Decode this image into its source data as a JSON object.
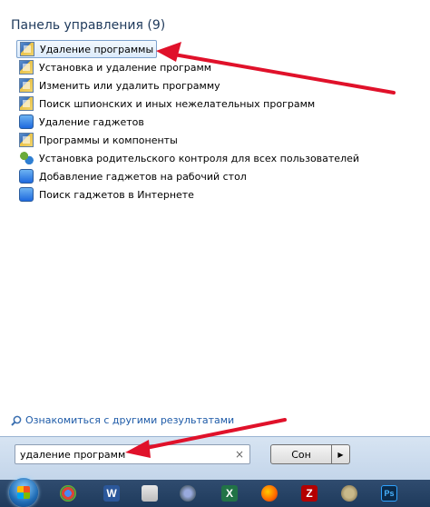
{
  "header": {
    "title": "Панель управления (9)"
  },
  "results": [
    {
      "label": "Удаление программы",
      "icon": "control-panel-icon"
    },
    {
      "label": "Установка и удаление программ",
      "icon": "control-panel-icon"
    },
    {
      "label": "Изменить или удалить программу",
      "icon": "control-panel-icon"
    },
    {
      "label": "Поиск шпионских и иных нежелательных программ",
      "icon": "control-panel-icon"
    },
    {
      "label": "Удаление гаджетов",
      "icon": "gadget-icon"
    },
    {
      "label": "Программы и компоненты",
      "icon": "control-panel-icon"
    },
    {
      "label": "Установка родительского контроля для всех пользователей",
      "icon": "parental-control-icon"
    },
    {
      "label": "Добавление гаджетов на рабочий стол",
      "icon": "gadget-icon"
    },
    {
      "label": "Поиск гаджетов в Интернете",
      "icon": "gadget-icon"
    }
  ],
  "more_results": {
    "label": "Ознакомиться с другими результатами"
  },
  "search": {
    "value": "удаление программ",
    "clear": "×"
  },
  "shutdown": {
    "label": "Сон",
    "arrow": "▶"
  },
  "taskbar": {
    "icons": [
      "start-orb",
      "chrome-icon",
      "word-icon",
      "snipping-icon",
      "network-icon",
      "excel-icon",
      "firefox-icon",
      "filezilla-icon",
      "gimp-icon",
      "photoshop-icon"
    ],
    "colors": {
      "arrow": "#e0112a",
      "taskbar": "#1e3a5c"
    }
  }
}
